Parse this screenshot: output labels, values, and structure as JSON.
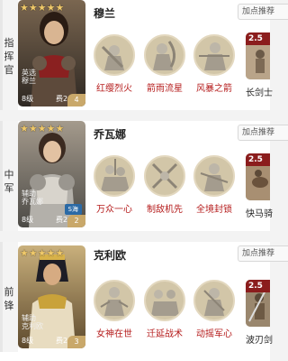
{
  "add_point_label": "加点推荐",
  "commanders": [
    {
      "role": "指挥官",
      "name": "穆兰",
      "stars": "★★★★★",
      "subtitle": "英选\n穆兰",
      "level": "8级",
      "rank": "费2",
      "corner": "4",
      "tag": "",
      "skills": [
        "红缨烈火",
        "箭雨流星",
        "风暴之箭"
      ],
      "item": {
        "value": "2.5",
        "label": "长剑士"
      }
    },
    {
      "role": "中军",
      "name": "乔瓦娜",
      "stars": "★★★★★",
      "subtitle": "辅助\n乔瓦娜",
      "level": "8级",
      "rank": "费2",
      "corner": "2",
      "tag": "S海",
      "skills": [
        "万众一心",
        "制敌机先",
        "全境封锁"
      ],
      "item": {
        "value": "2.5",
        "label": "快马骑"
      }
    },
    {
      "role": "前锋",
      "name": "克利欧",
      "stars": "★★★★★",
      "subtitle": "辅助\n克利欧",
      "level": "8级",
      "rank": "费2",
      "corner": "3",
      "tag": "",
      "skills": [
        "女神在世",
        "迁延战术",
        "动摇军心"
      ],
      "item": {
        "value": "2.5",
        "label": "波刃剑"
      }
    }
  ]
}
